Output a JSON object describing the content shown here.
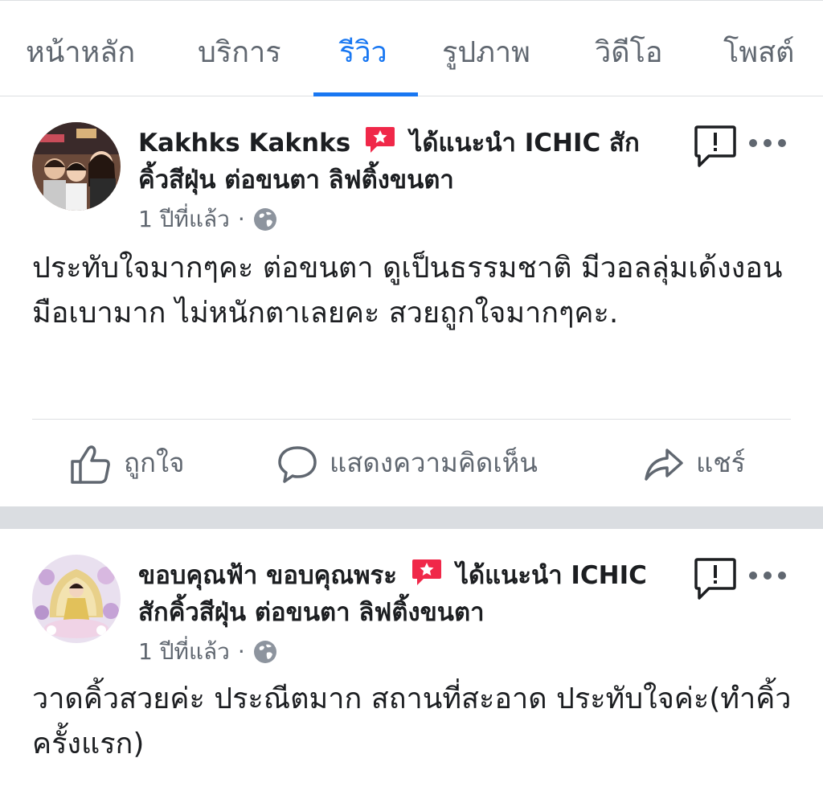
{
  "tabs": {
    "home": "หน้าหลัก",
    "services": "บริการ",
    "reviews": "รีวิว",
    "photos": "รูปภาพ",
    "videos": "วิดีโอ",
    "posts": "โพสต์",
    "active": "reviews",
    "accent_color": "#1877f2"
  },
  "reviews": [
    {
      "author": "Kakhks Kaknks",
      "recommendation_text": "ได้แนะนำ ICHIC สักคิ้วสีฝุ่น ต่อขนตา ลิฟติ้งขนตา",
      "time": "1 ปีที่แล้ว",
      "separator": "·",
      "body": "ประทับใจมากๆคะ ต่อขนตา ดูเป็นธรรมชาติ มีวอลลุ่มเด้งงอน มือเบามาก ไม่หนักตาเลยคะ สวยถูกใจมากๆคะ."
    },
    {
      "author": "ขอบคุณฟ้า ขอบคุณพระ",
      "recommendation_text": "ได้แนะนำ ICHIC สักคิ้วสีฝุ่น ต่อขนตา ลิฟติ้งขนตา",
      "time": "1 ปีที่แล้ว",
      "separator": "·",
      "body": "วาดคิ้วสวยค่ะ  ประณีตมาก สถานที่สะอาด ประทับใจค่ะ(ทำคิ้วครั้งแรก)"
    }
  ],
  "actions": {
    "like": "ถูกใจ",
    "comment": "แสดงความคิดเห็น",
    "share": "แชร์"
  },
  "icons": {
    "recommend_badge": "recommend-icon",
    "privacy": "globe-icon",
    "report": "report-icon",
    "more": "more-icon",
    "like": "thumbs-up-icon",
    "comment": "comment-icon",
    "share": "share-icon",
    "badge_color": "#f02849"
  }
}
